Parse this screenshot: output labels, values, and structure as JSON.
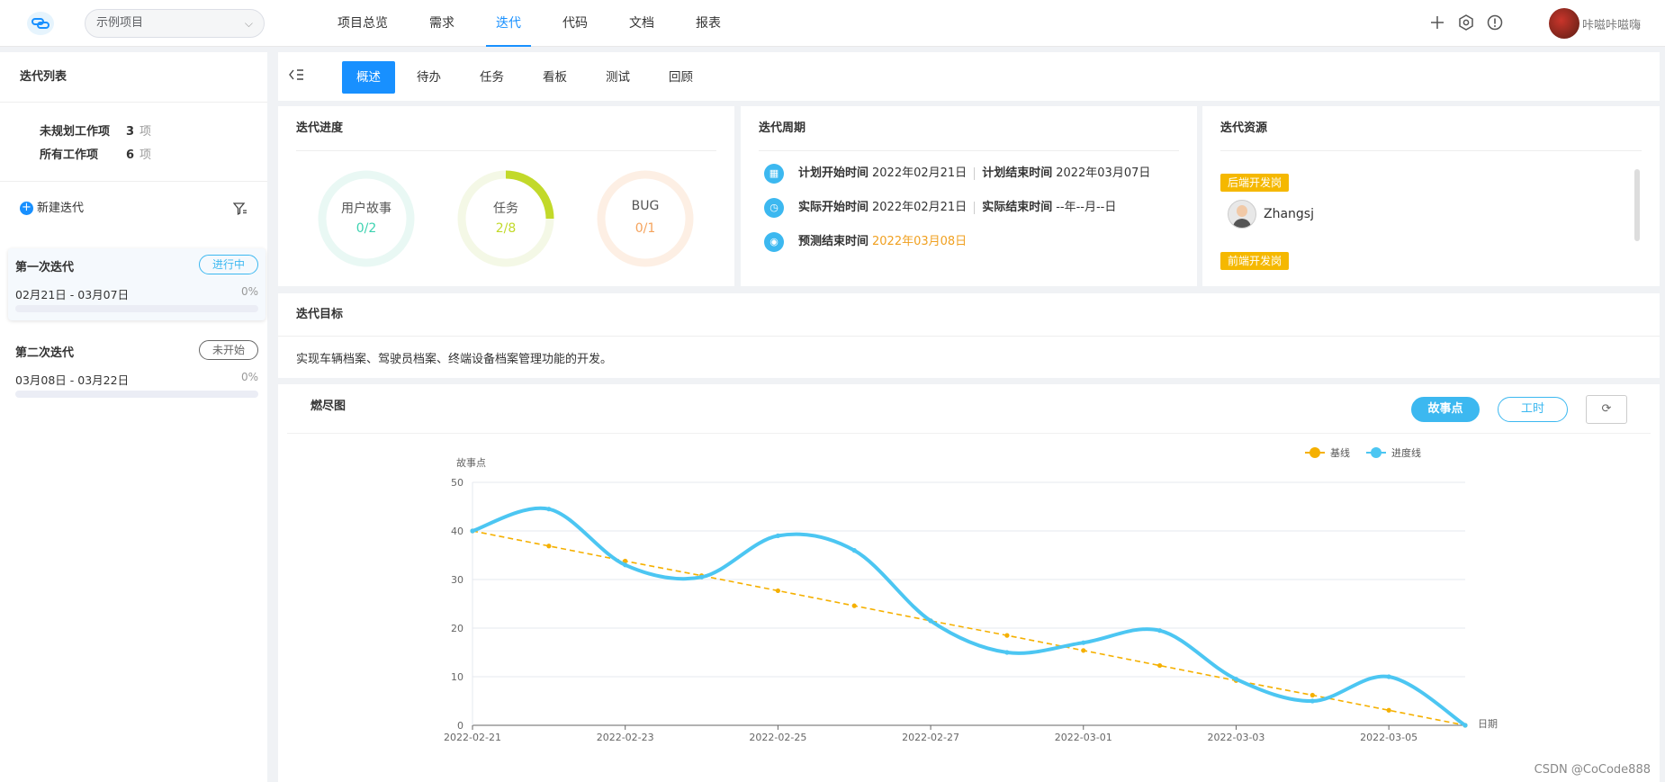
{
  "header": {
    "project": "示例项目",
    "nav": [
      "项目总览",
      "需求",
      "迭代",
      "代码",
      "文档",
      "报表"
    ],
    "nav_active": 2,
    "username": "咔嗞咔嗞嗨"
  },
  "sidebar": {
    "title": "迭代列表",
    "stats": [
      {
        "label": "未规划工作项",
        "count": "3",
        "unit": "项"
      },
      {
        "label": "所有工作项",
        "count": "6",
        "unit": "项"
      }
    ],
    "new_label": "新建迭代",
    "iterations": [
      {
        "name": "第一次迭代",
        "status": "进行中",
        "dates": "02月21日 - 03月07日",
        "progress": "0%"
      },
      {
        "name": "第二次迭代",
        "status": "未开始",
        "dates": "03月08日 - 03月22日",
        "progress": "0%"
      }
    ]
  },
  "tabs": [
    "概述",
    "待办",
    "任务",
    "看板",
    "测试",
    "回顾"
  ],
  "progress_panel": {
    "title": "迭代进度",
    "rings": [
      {
        "label": "用户故事",
        "value": "0/2",
        "fraction": 0,
        "color": "#3cd2b0",
        "track": "#e9f8f4"
      },
      {
        "label": "任务",
        "value": "2/8",
        "fraction": 0.25,
        "color": "#c2d92a",
        "track": "#f4f8e6"
      },
      {
        "label": "BUG",
        "value": "0/1",
        "fraction": 0,
        "color": "#f5a35c",
        "track": "#fdefe4"
      }
    ]
  },
  "cycle_panel": {
    "title": "迭代周期",
    "plan_start_label": "计划开始时间",
    "plan_start": "2022年02月21日",
    "plan_end_label": "计划结束时间",
    "plan_end": "2022年03月07日",
    "actual_start_label": "实际开始时间",
    "actual_start": "2022年02月21日",
    "actual_end_label": "实际结束时间",
    "actual_end": "--年--月--日",
    "forecast_label": "预测结束时间",
    "forecast": "2022年03月08日"
  },
  "resource_panel": {
    "title": "迭代资源",
    "groups": [
      "后端开发岗",
      "前端开发岗"
    ],
    "user": "Zhangsj"
  },
  "goal_panel": {
    "title": "迭代目标",
    "text": "实现车辆档案、驾驶员档案、终端设备档案管理功能的开发。"
  },
  "burndown": {
    "title": "燃尽图",
    "btn_story": "故事点",
    "btn_hours": "工时"
  },
  "chart_data": {
    "type": "line",
    "ylabel": "故事点",
    "xlabel": "日期",
    "ylim": [
      0,
      50
    ],
    "yticks": [
      0,
      10,
      20,
      30,
      40,
      50
    ],
    "xtick_labels": [
      "2022-02-21",
      "2022-02-23",
      "2022-02-25",
      "2022-02-27",
      "2022-03-01",
      "2022-03-03",
      "2022-03-05"
    ],
    "x": [
      "2022-02-21",
      "2022-02-22",
      "2022-02-23",
      "2022-02-24",
      "2022-02-25",
      "2022-02-26",
      "2022-02-27",
      "2022-02-28",
      "2022-03-01",
      "2022-03-02",
      "2022-03-03",
      "2022-03-04",
      "2022-03-05",
      "2022-03-06"
    ],
    "grid": true,
    "legend_position": "top-right",
    "series": [
      {
        "name": "基线",
        "color": "#f5b000",
        "dashed": true,
        "values": [
          40,
          36.9,
          33.8,
          30.8,
          27.7,
          24.6,
          21.5,
          18.5,
          15.4,
          12.3,
          9.2,
          6.2,
          3.1,
          0
        ]
      },
      {
        "name": "进度线",
        "color": "#4cc6f2",
        "dashed": false,
        "values": [
          40,
          44.5,
          33,
          30.5,
          39,
          36,
          21.5,
          15,
          17,
          19.5,
          9.5,
          5,
          10,
          0
        ]
      }
    ]
  },
  "watermark": "CSDN @CoCode888"
}
